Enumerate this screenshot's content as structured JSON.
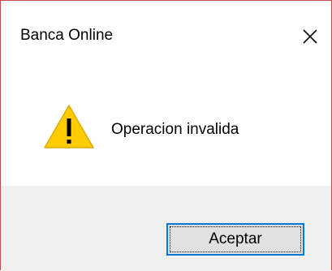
{
  "window": {
    "title": "Banca Online",
    "close_icon": "close-icon"
  },
  "dialog": {
    "icon": "warning-icon",
    "message": "Operacion invalida",
    "ok_label": "Aceptar"
  },
  "colors": {
    "border": "#c0504d",
    "footer_bg": "#f0f0f0",
    "button_border": "#0078d7",
    "warning_fill": "#ffcc00"
  }
}
